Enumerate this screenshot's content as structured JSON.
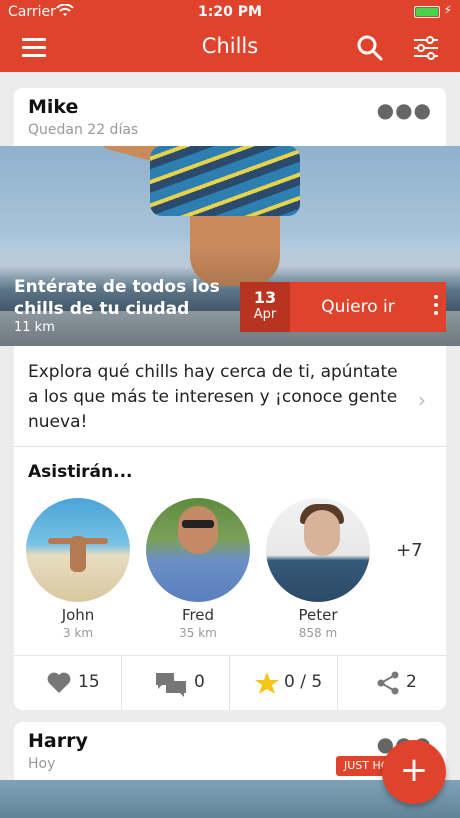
{
  "status_bar": {
    "carrier": "Carrier",
    "time": "1:20 PM"
  },
  "nav": {
    "title": "Chills"
  },
  "colors": {
    "accent": "#e0432b",
    "accent_dark": "#b83420",
    "star": "#f5c518"
  },
  "posts": [
    {
      "name": "Mike",
      "subtitle": "Quedan 22 días",
      "hero_title": "Entérate de todos los chills de tu ciudad",
      "distance": "11 km",
      "event_day": "13",
      "event_month": "Apr",
      "join_label": "Quiero ir",
      "description": "Explora qué chills hay cerca de ti, apúntate a los que más te interesen y ¡conoce gente nueva!",
      "attendees_title": "Asistirán...",
      "attendees": [
        {
          "name": "John",
          "distance": "3 km"
        },
        {
          "name": "Fred",
          "distance": "35 km"
        },
        {
          "name": "Peter",
          "distance": "858 m"
        }
      ],
      "more_attendees": "+7",
      "stats": {
        "likes": "15",
        "comments": "0",
        "rating": "0 / 5",
        "shares": "2"
      }
    },
    {
      "name": "Harry",
      "subtitle": "Hoy",
      "badge": "JUST HO"
    }
  ],
  "icons": [
    "menu-icon",
    "search-icon",
    "filter-icon",
    "more-icon",
    "heart-icon",
    "comments-icon",
    "star-icon",
    "share-icon",
    "plus-icon",
    "chevron-right-icon",
    "wifi-icon",
    "battery-icon"
  ]
}
